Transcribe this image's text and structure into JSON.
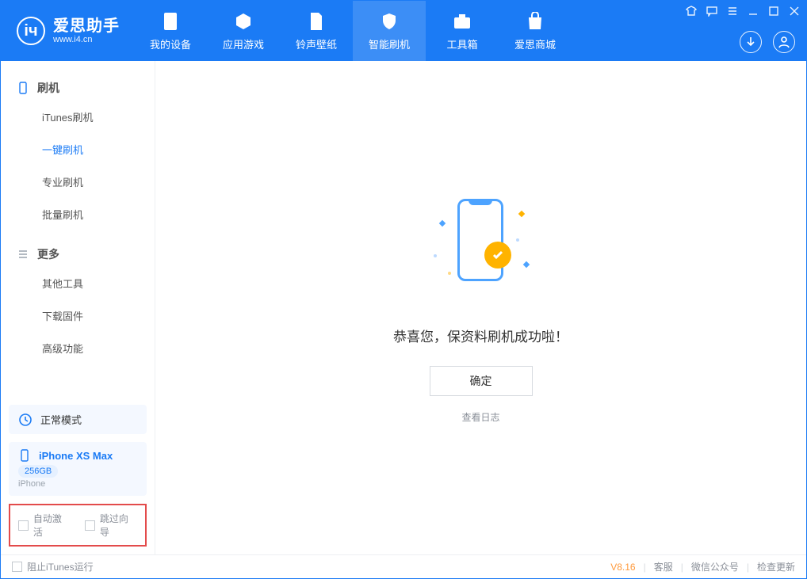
{
  "app": {
    "name_cn": "爱思助手",
    "name_en": "www.i4.cn"
  },
  "tabs": [
    {
      "label": "我的设备"
    },
    {
      "label": "应用游戏"
    },
    {
      "label": "铃声壁纸"
    },
    {
      "label": "智能刷机"
    },
    {
      "label": "工具箱"
    },
    {
      "label": "爱思商城"
    }
  ],
  "active_tab_index": 3,
  "sidebar": {
    "section1_title": "刷机",
    "section1_items": [
      "iTunes刷机",
      "一键刷机",
      "专业刷机",
      "批量刷机"
    ],
    "active_item_index": 1,
    "section2_title": "更多",
    "section2_items": [
      "其他工具",
      "下载固件",
      "高级功能"
    ]
  },
  "device": {
    "mode_label": "正常模式",
    "model": "iPhone XS Max",
    "storage": "256GB",
    "type": "iPhone"
  },
  "options": {
    "auto_activate": "自动激活",
    "skip_guide": "跳过向导"
  },
  "main": {
    "success_msg": "恭喜您，保资料刷机成功啦！",
    "ok_label": "确定",
    "view_log": "查看日志"
  },
  "footer": {
    "block_itunes": "阻止iTunes运行",
    "version": "V8.16",
    "links": [
      "客服",
      "微信公众号",
      "检查更新"
    ]
  }
}
